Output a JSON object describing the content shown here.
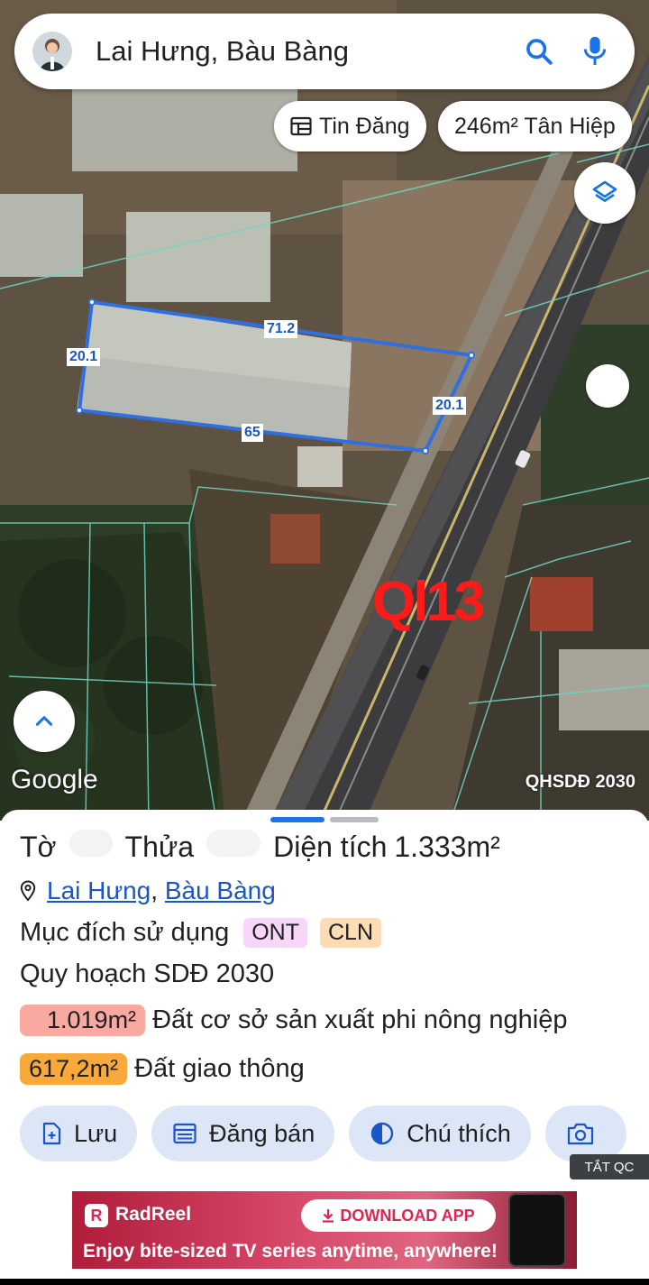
{
  "search": {
    "query": "Lai Hưng, Bàu Bàng"
  },
  "chips": [
    {
      "label": "Tin Đăng",
      "icon": "listing-icon"
    },
    {
      "label": "246m² Tân Hiệp"
    }
  ],
  "map": {
    "parcel_dimensions": {
      "top": "71.2",
      "left": "20.1",
      "right": "20.1",
      "bottom": "65"
    },
    "road_label": "Ql13",
    "attribution": "Google",
    "layer_name": "QHSDĐ 2030"
  },
  "parcel": {
    "sheet_label": "Tờ",
    "plot_label": "Thửa",
    "area_label": "Diện tích",
    "area_value": "1.333m²",
    "location": {
      "commune": "Lai Hưng",
      "separator": ", ",
      "district": "Bàu Bàng"
    },
    "purpose_label": "Mục đích sử dụng",
    "purpose_tags": [
      "ONT",
      "CLN"
    ],
    "plan_label": "Quy hoạch SDĐ 2030",
    "zones": [
      {
        "area": "1.019m²",
        "description": "Đất cơ sở sản xuất phi nông nghiệp",
        "color": "#f9a9a0"
      },
      {
        "area": "617,2m²",
        "description": "Đất giao thông",
        "color": "#f7a93b"
      }
    ]
  },
  "actions": [
    {
      "label": "Lưu",
      "icon": "save-icon"
    },
    {
      "label": "Đăng bán",
      "icon": "calendar-icon"
    },
    {
      "label": "Chú thích",
      "icon": "legend-icon"
    },
    {
      "label": "",
      "icon": "camera-icon"
    }
  ],
  "ad": {
    "close_label": "TẮT QC",
    "brand": "RadReel",
    "cta": "DOWNLOAD APP",
    "tagline": "Enjoy bite-sized TV series anytime, anywhere!"
  },
  "colors": {
    "accent": "#1a73e8",
    "parcel_outline": "#2f6fe0",
    "road_label": "#ff1a1a",
    "action_bg": "#dce6f6"
  }
}
